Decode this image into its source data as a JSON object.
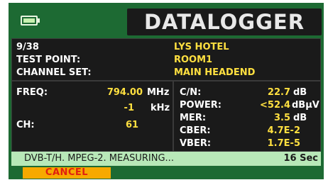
{
  "header": {
    "title": "DATALOGGER",
    "battery_icon": "battery-icon"
  },
  "info": {
    "index": "9/38",
    "site": "LYS HOTEL",
    "test_point_label": "TEST POINT:",
    "test_point_value": "ROOM1",
    "channel_set_label": "CHANNEL SET:",
    "channel_set_value": "MAIN HEADEND"
  },
  "tuning": {
    "freq_label": "FREQ:",
    "freq_value": "794.00",
    "freq_unit": "MHz",
    "offset_value": "-1",
    "offset_unit": "kHz",
    "ch_label": "CH:",
    "ch_value": "61"
  },
  "measurements": [
    {
      "label": "C/N:",
      "value": "22.7",
      "unit": "dB"
    },
    {
      "label": "POWER:",
      "value": "<52.4",
      "unit": "dBµV"
    },
    {
      "label": "MER:",
      "value": "3.5",
      "unit": "dB"
    },
    {
      "label": "CBER:",
      "value": "4.7E-2",
      "unit": ""
    },
    {
      "label": "VBER:",
      "value": "1.7E-5",
      "unit": ""
    }
  ],
  "status": {
    "message": "DVB-T/H. MPEG-2. MEASURING...",
    "time": "16 Sec"
  },
  "actions": {
    "cancel_label": "CANCEL"
  },
  "colors": {
    "screen_bg": "#1d6a33",
    "panel_bg": "#1a1a1a",
    "value_color": "#ffe040",
    "status_bg": "#b8e8b8",
    "cancel_bg": "#f7a900",
    "cancel_text": "#e02010"
  }
}
